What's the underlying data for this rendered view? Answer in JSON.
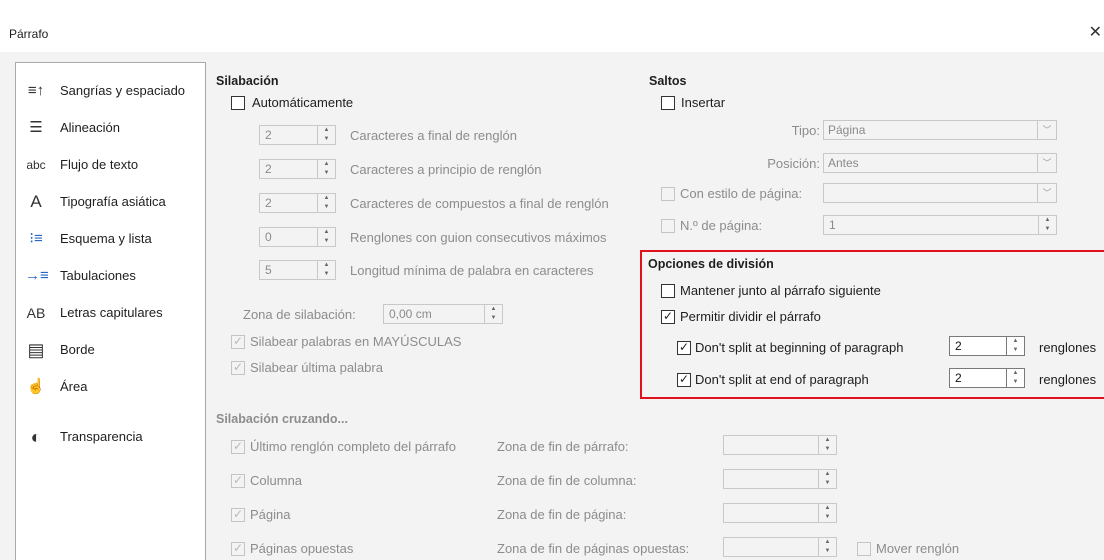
{
  "window": {
    "title": "Párrafo",
    "close_glyph": "✕"
  },
  "sidebar": {
    "items": [
      {
        "label": "Sangrías y espaciado",
        "icon": "indent-spacing-icon",
        "glyph": "≡↑"
      },
      {
        "label": "Alineación",
        "icon": "alignment-icon",
        "glyph": "☰"
      },
      {
        "label": "Flujo de texto",
        "icon": "text-flow-icon",
        "glyph": "abc"
      },
      {
        "label": "Tipografía asiática",
        "icon": "asian-typography-icon",
        "glyph": "A"
      },
      {
        "label": "Esquema y lista",
        "icon": "outline-list-icon",
        "glyph": "⁝≡"
      },
      {
        "label": "Tabulaciones",
        "icon": "tabs-icon",
        "glyph": "→≡"
      },
      {
        "label": "Letras capitulares",
        "icon": "drop-caps-icon",
        "glyph": "AB"
      },
      {
        "label": "Borde",
        "icon": "border-icon",
        "glyph": "▤"
      },
      {
        "label": "Área",
        "icon": "area-icon",
        "glyph": "☝"
      },
      {
        "label": "Transparencia",
        "icon": "transparency-icon",
        "glyph": "◐"
      }
    ]
  },
  "hyphenation": {
    "heading": "Silabación",
    "automatic_label": "Automáticamente",
    "rows": [
      {
        "value": "2",
        "label": "Caracteres a final de renglón"
      },
      {
        "value": "2",
        "label": "Caracteres a principio de renglón"
      },
      {
        "value": "2",
        "label": "Caracteres de compuestos a final de renglón"
      },
      {
        "value": "0",
        "label": "Renglones con guion consecutivos máximos"
      },
      {
        "value": "5",
        "label": "Longitud mínima de palabra en caracteres"
      }
    ],
    "zone_label": "Zona de silabación:",
    "zone_value": "0,00 cm",
    "caps_label": "Silabear palabras en MAYÚSCULAS",
    "last_word_label": "Silabear última palabra"
  },
  "breaks": {
    "heading": "Saltos",
    "insert_label": "Insertar",
    "type_label": "Tipo:",
    "type_value": "Página",
    "position_label": "Posición:",
    "position_value": "Antes",
    "page_style_label": "Con estilo de página:",
    "page_style_value": "",
    "page_number_label": "N.º de página:",
    "page_number_value": "1"
  },
  "split_options": {
    "heading": "Opciones de división",
    "keep_next_label": "Mantener junto al párrafo siguiente",
    "allow_split_label": "Permitir dividir el párrafo",
    "no_split_start_label": "Don't split at beginning of paragraph",
    "no_split_start_value": "2",
    "no_split_end_label": "Don't split at end of paragraph",
    "no_split_end_value": "2",
    "lines_unit": "renglones",
    "highlight_color": "#e0101c"
  },
  "cross_hyphenation": {
    "heading": "Silabación cruzando...",
    "rows": [
      {
        "check_label": "Último renglón completo del párrafo",
        "zone_label": "Zona de fin de párrafo:"
      },
      {
        "check_label": "Columna",
        "zone_label": "Zona de fin de columna:"
      },
      {
        "check_label": "Página",
        "zone_label": "Zona de fin de página:"
      },
      {
        "check_label": "Páginas opuestas",
        "zone_label": "Zona de fin de páginas opuestas:"
      }
    ],
    "move_line_label": "Mover renglón"
  }
}
